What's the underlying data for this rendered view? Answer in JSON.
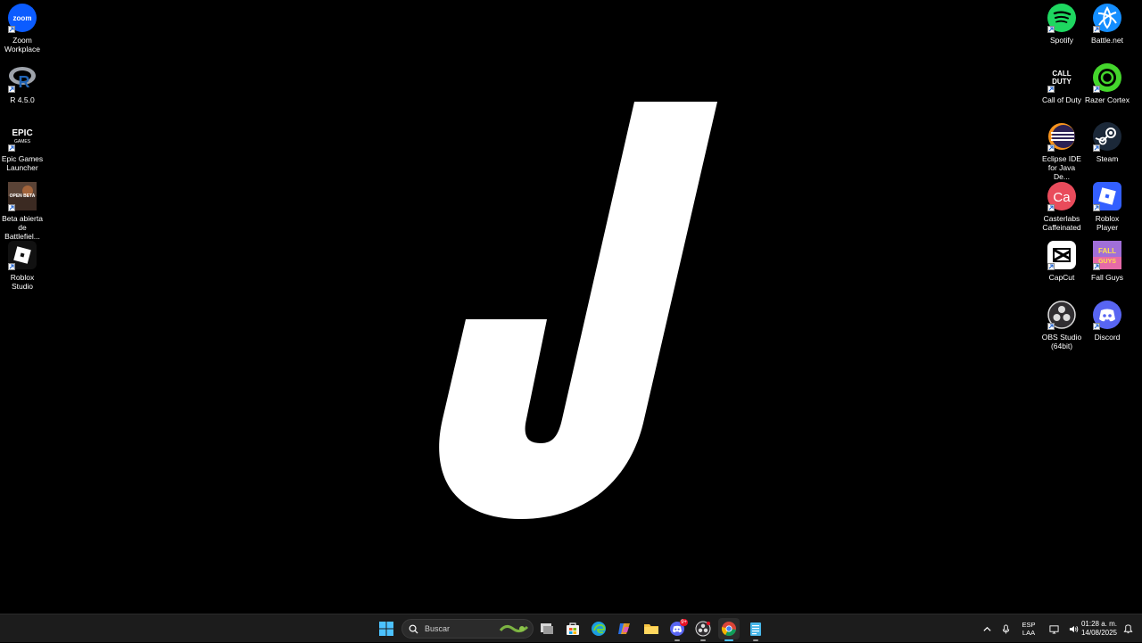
{
  "desktop": {
    "left_icons": [
      {
        "label": "Zoom Workplace",
        "icon": "zoom-icon",
        "badge_text": "zoom"
      },
      {
        "label": "R 4.5.0",
        "icon": "r-icon"
      },
      {
        "label": "Epic Games Launcher",
        "icon": "epic-games-icon",
        "badge_text": "EPIC",
        "sub_text": "GAMES"
      },
      {
        "label": "Beta abierta de Battlefiel...",
        "icon": "battlefield-icon",
        "badge_text": "OPEN BETA"
      },
      {
        "label": "Roblox Studio",
        "icon": "roblox-studio-icon"
      }
    ],
    "right_col1_icons": [
      {
        "label": "Spotify",
        "icon": "spotify-icon"
      },
      {
        "label": "Call of Duty",
        "icon": "call-of-duty-icon",
        "badge_text": "CALL OF DUTY"
      },
      {
        "label": "Eclipse IDE for Java De...",
        "icon": "eclipse-icon"
      },
      {
        "label": "Casterlabs Caffeinated",
        "icon": "casterlabs-icon",
        "badge_text": "Ca"
      },
      {
        "label": "CapCut",
        "icon": "capcut-icon"
      },
      {
        "label": "OBS Studio (64bit)",
        "icon": "obs-icon"
      }
    ],
    "right_col2_icons": [
      {
        "label": "Battle.net",
        "icon": "battlenet-icon"
      },
      {
        "label": "Razer Cortex",
        "icon": "razer-cortex-icon"
      },
      {
        "label": "Steam",
        "icon": "steam-icon"
      },
      {
        "label": "Roblox Player",
        "icon": "roblox-player-icon"
      },
      {
        "label": "Fall Guys",
        "icon": "fall-guys-icon",
        "badge_text": "FALL GUYS"
      },
      {
        "label": "Discord",
        "icon": "discord-icon"
      }
    ],
    "wallpaper": {
      "glyph": "J",
      "color": "#ffffff",
      "background": "#000000"
    }
  },
  "taskbar": {
    "search_placeholder": "Buscar",
    "apps": [
      {
        "name": "start",
        "icon": "windows-start-icon"
      },
      {
        "name": "task-view",
        "icon": "task-view-icon"
      },
      {
        "name": "store",
        "icon": "microsoft-store-icon"
      },
      {
        "name": "edge",
        "icon": "edge-icon"
      },
      {
        "name": "copilot",
        "icon": "copilot-icon"
      },
      {
        "name": "file-explorer",
        "icon": "folder-icon"
      },
      {
        "name": "discord",
        "icon": "discord-icon",
        "badge": "9+"
      },
      {
        "name": "obs",
        "icon": "obs-icon"
      },
      {
        "name": "chrome",
        "icon": "chrome-icon",
        "active": true
      },
      {
        "name": "notepad",
        "icon": "notepad-icon"
      }
    ],
    "tray": {
      "language_line1": "ESP",
      "language_line2": "LAA",
      "time": "01:28 a. m.",
      "date": "14/08/2025"
    }
  },
  "colors": {
    "taskbar_bg": "#1c1c1c",
    "accent": "#4cc2ff",
    "spotify": "#1ed760",
    "zoom": "#0b5cff",
    "discord": "#5865f2",
    "steam": "#1b2838"
  }
}
